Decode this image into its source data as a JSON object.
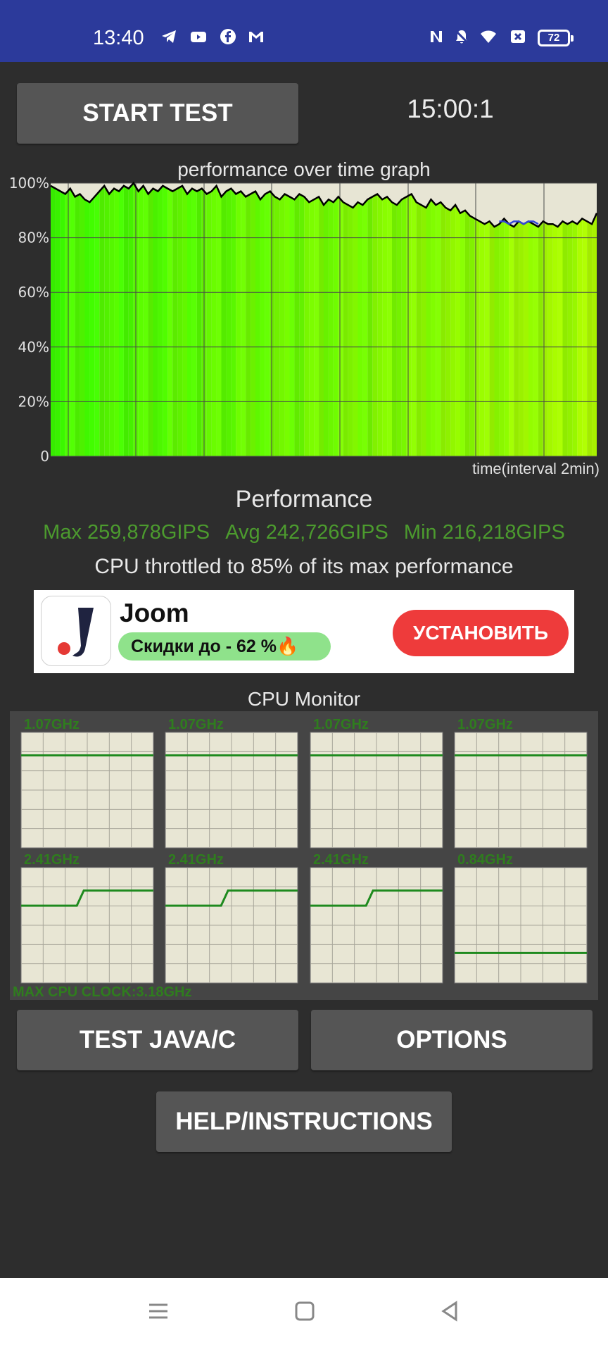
{
  "status_bar": {
    "time": "13:40",
    "battery": "72",
    "left_icons": [
      "telegram-icon",
      "youtube-icon",
      "facebook-icon",
      "gmail-icon"
    ],
    "right_icons": [
      "nfc-icon",
      "mute-bell-icon",
      "wifi-icon",
      "close-box-icon",
      "battery-icon"
    ]
  },
  "controls": {
    "start_test": "START TEST",
    "timer": "15:00:1",
    "test_java_c": "TEST JAVA/C",
    "options": "OPTIONS",
    "help": "HELP/INSTRUCTIONS"
  },
  "performance": {
    "graph_title": "performance over time graph",
    "heading": "Performance",
    "max": "Max 259,878GIPS",
    "avg": "Avg 242,726GIPS",
    "min": "Min 216,218GIPS",
    "throttle_text": "CPU throttled to 85% of its max performance",
    "xlabel": "time(interval 2min)"
  },
  "chart_data": [
    {
      "type": "line",
      "title": "performance over time graph",
      "xlabel": "time(interval 2min)",
      "ylabel": "",
      "y_ticks": [
        "100%",
        "80%",
        "60%",
        "40%",
        "20%",
        "0"
      ],
      "ylim": [
        0,
        100
      ],
      "xlim": [
        0,
        112
      ],
      "grid": true,
      "series": [
        {
          "color": "#000000",
          "values": [
            99,
            98,
            97,
            96,
            98,
            95,
            96,
            94,
            93,
            95,
            97,
            99,
            96,
            98,
            97,
            99,
            98,
            100,
            97,
            99,
            96,
            98,
            97,
            99,
            98,
            97,
            98,
            99,
            96,
            98,
            97,
            98,
            96,
            97,
            99,
            95,
            97,
            98,
            96,
            97,
            95,
            96,
            97,
            94,
            96,
            97,
            95,
            94,
            96,
            95,
            94,
            96,
            95,
            93,
            94,
            95,
            92,
            94,
            93,
            95,
            93,
            92,
            91,
            93,
            92,
            94,
            95,
            96,
            94,
            95,
            93,
            92,
            94,
            95,
            96,
            93,
            92,
            91,
            94,
            92,
            93,
            91,
            90,
            92,
            89,
            90,
            88,
            87,
            86,
            85,
            86,
            84,
            85,
            87,
            85,
            84,
            86,
            85,
            86,
            85,
            84,
            86,
            85,
            85,
            84,
            86,
            85,
            86,
            85,
            87,
            86,
            85,
            89
          ]
        },
        {
          "color": "#3347d8",
          "x_range": [
            92,
            100
          ],
          "values": [
            86,
            86,
            85,
            86,
            86,
            85,
            86,
            86,
            85
          ]
        }
      ]
    },
    {
      "type": "line",
      "title": "CPU Monitor",
      "charts": [
        {
          "freq": "1.07GHz",
          "values": [
            80,
            80,
            80,
            80,
            80,
            80,
            80,
            80,
            80,
            80,
            80,
            80,
            80,
            80,
            80,
            80,
            80,
            80,
            80,
            80
          ]
        },
        {
          "freq": "1.07GHz",
          "values": [
            80,
            80,
            80,
            80,
            80,
            80,
            80,
            80,
            80,
            80,
            80,
            80,
            80,
            80,
            80,
            80,
            80,
            80,
            80,
            80
          ]
        },
        {
          "freq": "1.07GHz",
          "values": [
            80,
            80,
            80,
            80,
            80,
            80,
            80,
            80,
            80,
            80,
            80,
            80,
            80,
            80,
            80,
            80,
            80,
            80,
            80,
            80
          ]
        },
        {
          "freq": "1.07GHz",
          "values": [
            80,
            80,
            80,
            80,
            80,
            80,
            80,
            80,
            80,
            80,
            80,
            80,
            80,
            80,
            80,
            80,
            80,
            80,
            80,
            80
          ]
        },
        {
          "freq": "2.41GHz",
          "values": [
            67,
            67,
            67,
            67,
            67,
            67,
            67,
            67,
            67,
            80,
            80,
            80,
            80,
            80,
            80,
            80,
            80,
            80,
            80,
            80
          ]
        },
        {
          "freq": "2.41GHz",
          "values": [
            67,
            67,
            67,
            67,
            67,
            67,
            67,
            67,
            67,
            80,
            80,
            80,
            80,
            80,
            80,
            80,
            80,
            80,
            80,
            80
          ]
        },
        {
          "freq": "2.41GHz",
          "values": [
            67,
            67,
            67,
            67,
            67,
            67,
            67,
            67,
            67,
            80,
            80,
            80,
            80,
            80,
            80,
            80,
            80,
            80,
            80,
            80
          ]
        },
        {
          "freq": "0.84GHz",
          "values": [
            26,
            26,
            26,
            26,
            26,
            26,
            26,
            26,
            26,
            26,
            26,
            26,
            26,
            26,
            26,
            26,
            26,
            26,
            26,
            26
          ]
        }
      ],
      "footer": "MAX CPU CLOCK:3.18GHz"
    }
  ],
  "ad": {
    "title": "Joom",
    "badge": "Скидки до - 62 %🔥",
    "install": "УСТАНОВИТЬ"
  },
  "cpu_monitor": {
    "title": "CPU Monitor",
    "max_clock": "MAX CPU CLOCK:3.18GHz",
    "freqs": [
      "1.07GHz",
      "1.07GHz",
      "1.07GHz",
      "1.07GHz",
      "2.41GHz",
      "2.41GHz",
      "2.41GHz",
      "0.84GHz"
    ]
  },
  "nav_bar": {
    "icons": [
      "menu-icon",
      "home-icon",
      "back-icon"
    ]
  }
}
